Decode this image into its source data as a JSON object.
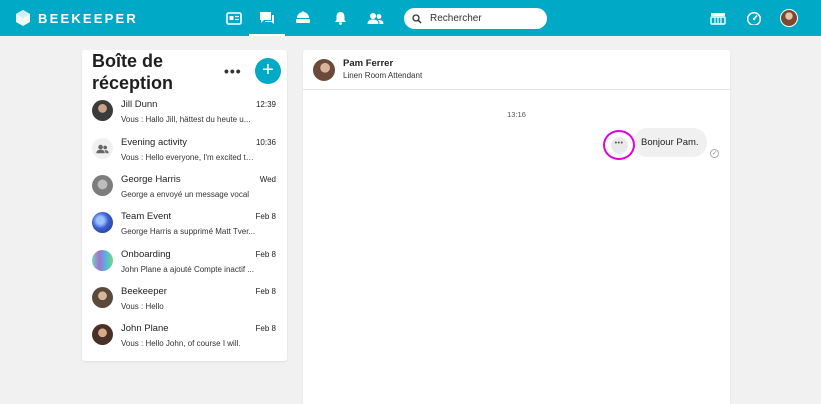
{
  "app": {
    "brand": "BEEKEEPER"
  },
  "colors": {
    "accent": "#00a9c5",
    "highlight": "#e000e0"
  },
  "nav": {
    "icons": [
      "news-feed-icon",
      "messages-icon",
      "launcher-icon",
      "notifications-icon",
      "people-icon"
    ],
    "active": "messages-icon",
    "right_icons": [
      "streams-icon",
      "dashboard-icon",
      "user-avatar"
    ]
  },
  "search": {
    "placeholder": "Rechercher"
  },
  "inbox": {
    "title": "Boîte de réception",
    "more_label": "•••",
    "compose_label": "+",
    "conversations": [
      {
        "name": "Jill Dunn",
        "time": "12:39",
        "preview": "Vous : Hallo Jill, hättest du heute u...",
        "avatar": "photo"
      },
      {
        "name": "Evening activity",
        "time": "10:36",
        "preview": "Vous : Hello everyone, I'm excited to...",
        "avatar": "group-icon"
      },
      {
        "name": "George Harris",
        "time": "Wed",
        "preview": "George a envoyé un message vocal",
        "avatar": "photo"
      },
      {
        "name": "Team Event",
        "time": "Feb 8",
        "preview": "George Harris a supprimé Matt Tver...",
        "avatar": "photo"
      },
      {
        "name": "Onboarding",
        "time": "Feb 8",
        "preview": "John Plane a ajouté Compte inactif ...",
        "avatar": "photo"
      },
      {
        "name": "Beekeeper",
        "time": "Feb 8",
        "preview": "Vous : Hello",
        "avatar": "photo"
      },
      {
        "name": "John Plane",
        "time": "Feb 8",
        "preview": "Vous : Hello John, of course I will.",
        "avatar": "photo"
      }
    ]
  },
  "chat": {
    "contact_name": "Pam Ferrer",
    "contact_role": "Linen Room Attendant",
    "timestamp": "13:16",
    "message": "Bonjour Pam.",
    "message_more_label": "•••",
    "read_mark": "✓"
  }
}
